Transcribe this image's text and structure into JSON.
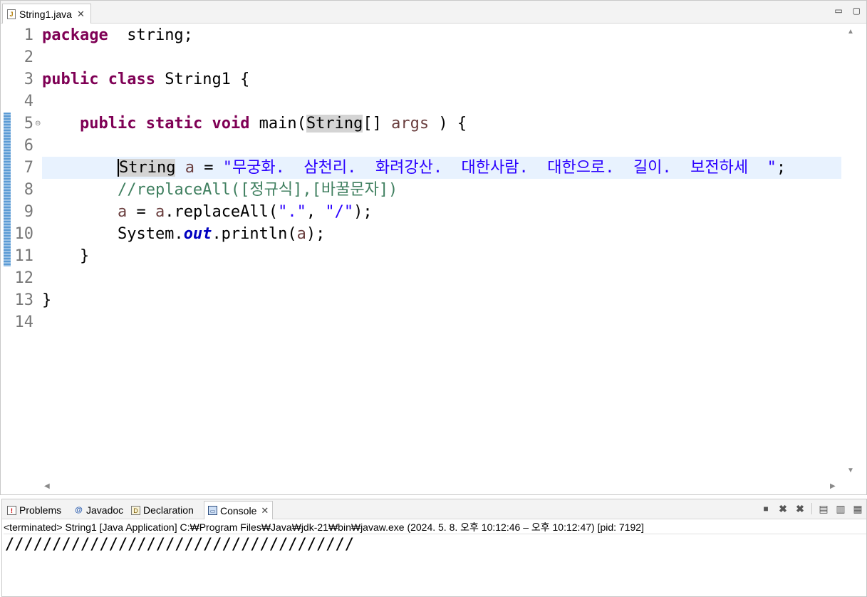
{
  "editor": {
    "tab_title": "String1.java",
    "tab_close": "✕",
    "minimize_glyph": "▭",
    "maximize_glyph": "▢",
    "line_numbers": [
      "1",
      "2",
      "3",
      "4",
      "5",
      "6",
      "7",
      "8",
      "9",
      "10",
      "11",
      "12",
      "13",
      "14"
    ],
    "lines": [
      {
        "n": 1,
        "tokens": [
          [
            "kw",
            "package"
          ],
          [
            "",
            "  string;"
          ]
        ]
      },
      {
        "n": 2,
        "tokens": []
      },
      {
        "n": 3,
        "tokens": [
          [
            "kw",
            "public"
          ],
          [
            "",
            " "
          ],
          [
            "kw",
            "class"
          ],
          [
            "",
            " String1 {"
          ]
        ]
      },
      {
        "n": 4,
        "tokens": []
      },
      {
        "n": 5,
        "tokens": [
          [
            "",
            "    "
          ],
          [
            "kw",
            "public"
          ],
          [
            "",
            " "
          ],
          [
            "kw",
            "static"
          ],
          [
            "",
            " "
          ],
          [
            "kw",
            "void"
          ],
          [
            "",
            " main("
          ],
          [
            "occ",
            "String"
          ],
          [
            "",
            "[] "
          ],
          [
            "param",
            "args"
          ],
          [
            "",
            " ) {"
          ]
        ]
      },
      {
        "n": 6,
        "tokens": []
      },
      {
        "n": 7,
        "tokens": [
          [
            "",
            "        "
          ],
          [
            "occ caret",
            "String"
          ],
          [
            "",
            " "
          ],
          [
            "param",
            "a"
          ],
          [
            "",
            " = "
          ],
          [
            "str",
            "\"무궁화.  삼천리.  화려강산.  대한사람.  대한으로.  길이.  보전하세  \""
          ],
          [
            "",
            ";"
          ]
        ]
      },
      {
        "n": 8,
        "tokens": [
          [
            "",
            "        "
          ],
          [
            "cmt",
            "//replaceAll([정규식],[바꿀문자])"
          ]
        ]
      },
      {
        "n": 9,
        "tokens": [
          [
            "",
            "        "
          ],
          [
            "param",
            "a"
          ],
          [
            "",
            " = "
          ],
          [
            "param",
            "a"
          ],
          [
            "",
            ".replaceAll("
          ],
          [
            "str",
            "\".\""
          ],
          [
            "",
            ", "
          ],
          [
            "str",
            "\"/\""
          ],
          [
            "",
            ");"
          ]
        ]
      },
      {
        "n": 10,
        "tokens": [
          [
            "",
            "        System."
          ],
          [
            "field",
            "out"
          ],
          [
            "",
            ".println("
          ],
          [
            "param",
            "a"
          ],
          [
            "",
            ");"
          ]
        ]
      },
      {
        "n": 11,
        "tokens": [
          [
            "",
            "    }"
          ]
        ]
      },
      {
        "n": 12,
        "tokens": []
      },
      {
        "n": 13,
        "tokens": [
          [
            "",
            "}"
          ]
        ]
      },
      {
        "n": 14,
        "tokens": []
      }
    ],
    "current_line": 7,
    "fold_line": 5
  },
  "bottom_panel": {
    "tabs": [
      {
        "label": "Problems",
        "icon": "problems-icon",
        "active": false
      },
      {
        "label": "Javadoc",
        "icon": "javadoc-icon",
        "active": false
      },
      {
        "label": "Declaration",
        "icon": "declaration-icon",
        "active": false
      },
      {
        "label": "Console",
        "icon": "console-icon",
        "active": true
      }
    ],
    "console_close": "✕",
    "status": "<terminated> String1 [Java Application] C:₩Program Files₩Java₩jdk-21₩bin₩javaw.exe  (2024. 5. 8. 오후 10:12:46 – 오후 10:12:47) [pid: 7192]",
    "output": "/////////////////////////////////////"
  }
}
